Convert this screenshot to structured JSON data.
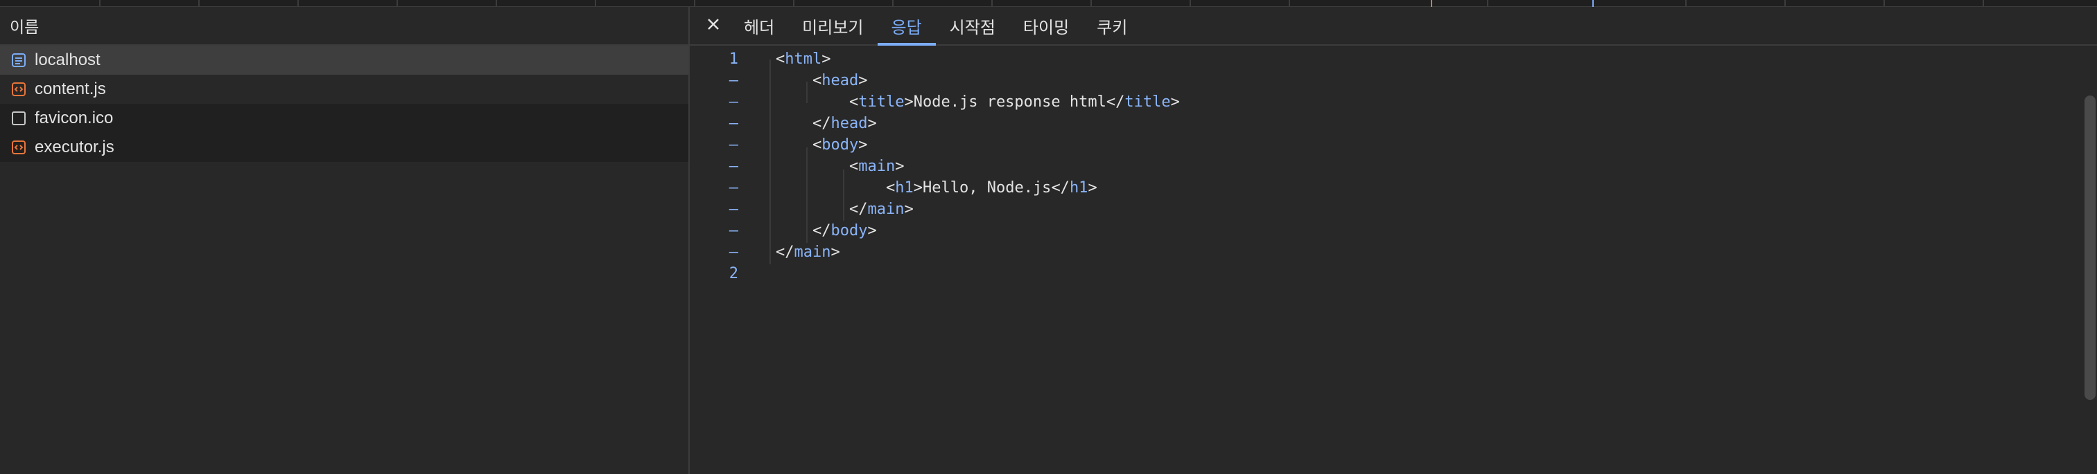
{
  "network_list": {
    "column_header": "이름",
    "rows": [
      {
        "name": "localhost",
        "icon": "document-icon",
        "icon_color": "#7cacf8"
      },
      {
        "name": "content.js",
        "icon": "script-icon",
        "icon_color": "#e8753a"
      },
      {
        "name": "favicon.ico",
        "icon": "file-icon",
        "icon_color": "#c4c7c5"
      },
      {
        "name": "executor.js",
        "icon": "script-icon",
        "icon_color": "#e8753a"
      }
    ]
  },
  "detail_tabs": {
    "close_icon": "close-icon",
    "tabs": [
      {
        "label": "헤더",
        "active": false
      },
      {
        "label": "미리보기",
        "active": false
      },
      {
        "label": "응답",
        "active": true
      },
      {
        "label": "시작점",
        "active": false
      },
      {
        "label": "타이밍",
        "active": false
      },
      {
        "label": "쿠키",
        "active": false
      }
    ]
  },
  "response": {
    "lines": [
      {
        "gutter": "1",
        "indent": 0,
        "open": "<",
        "tag": "html",
        "text": "",
        "close_tag": "",
        "end": ">"
      },
      {
        "gutter": "–",
        "indent": 1,
        "open": "<",
        "tag": "head",
        "text": "",
        "close_tag": "",
        "end": ">"
      },
      {
        "gutter": "–",
        "indent": 2,
        "open": "<",
        "tag": "title",
        "text": "Node.js response html",
        "close_tag": "title",
        "end": ">"
      },
      {
        "gutter": "–",
        "indent": 1,
        "open": "</",
        "tag": "head",
        "text": "",
        "close_tag": "",
        "end": ">"
      },
      {
        "gutter": "–",
        "indent": 1,
        "open": "<",
        "tag": "body",
        "text": "",
        "close_tag": "",
        "end": ">"
      },
      {
        "gutter": "–",
        "indent": 2,
        "open": "<",
        "tag": "main",
        "text": "",
        "close_tag": "",
        "end": ">"
      },
      {
        "gutter": "–",
        "indent": 3,
        "open": "<",
        "tag": "h1",
        "text": "Hello, Node.js",
        "close_tag": "h1",
        "end": ">"
      },
      {
        "gutter": "–",
        "indent": 2,
        "open": "</",
        "tag": "main",
        "text": "",
        "close_tag": "",
        "end": ">"
      },
      {
        "gutter": "–",
        "indent": 1,
        "open": "</",
        "tag": "body",
        "text": "",
        "close_tag": "",
        "end": ">"
      },
      {
        "gutter": "–",
        "indent": 0,
        "open": "</",
        "tag": "main",
        "text": "",
        "close_tag": "",
        "end": ">"
      },
      {
        "gutter": "2",
        "indent": 0,
        "open": "",
        "tag": "",
        "text": "",
        "close_tag": "",
        "end": ""
      }
    ]
  },
  "colors": {
    "accent": "#7cacf8",
    "tag": "#8ab4f8",
    "background": "#282828",
    "selected_row": "#3e3e3e"
  }
}
